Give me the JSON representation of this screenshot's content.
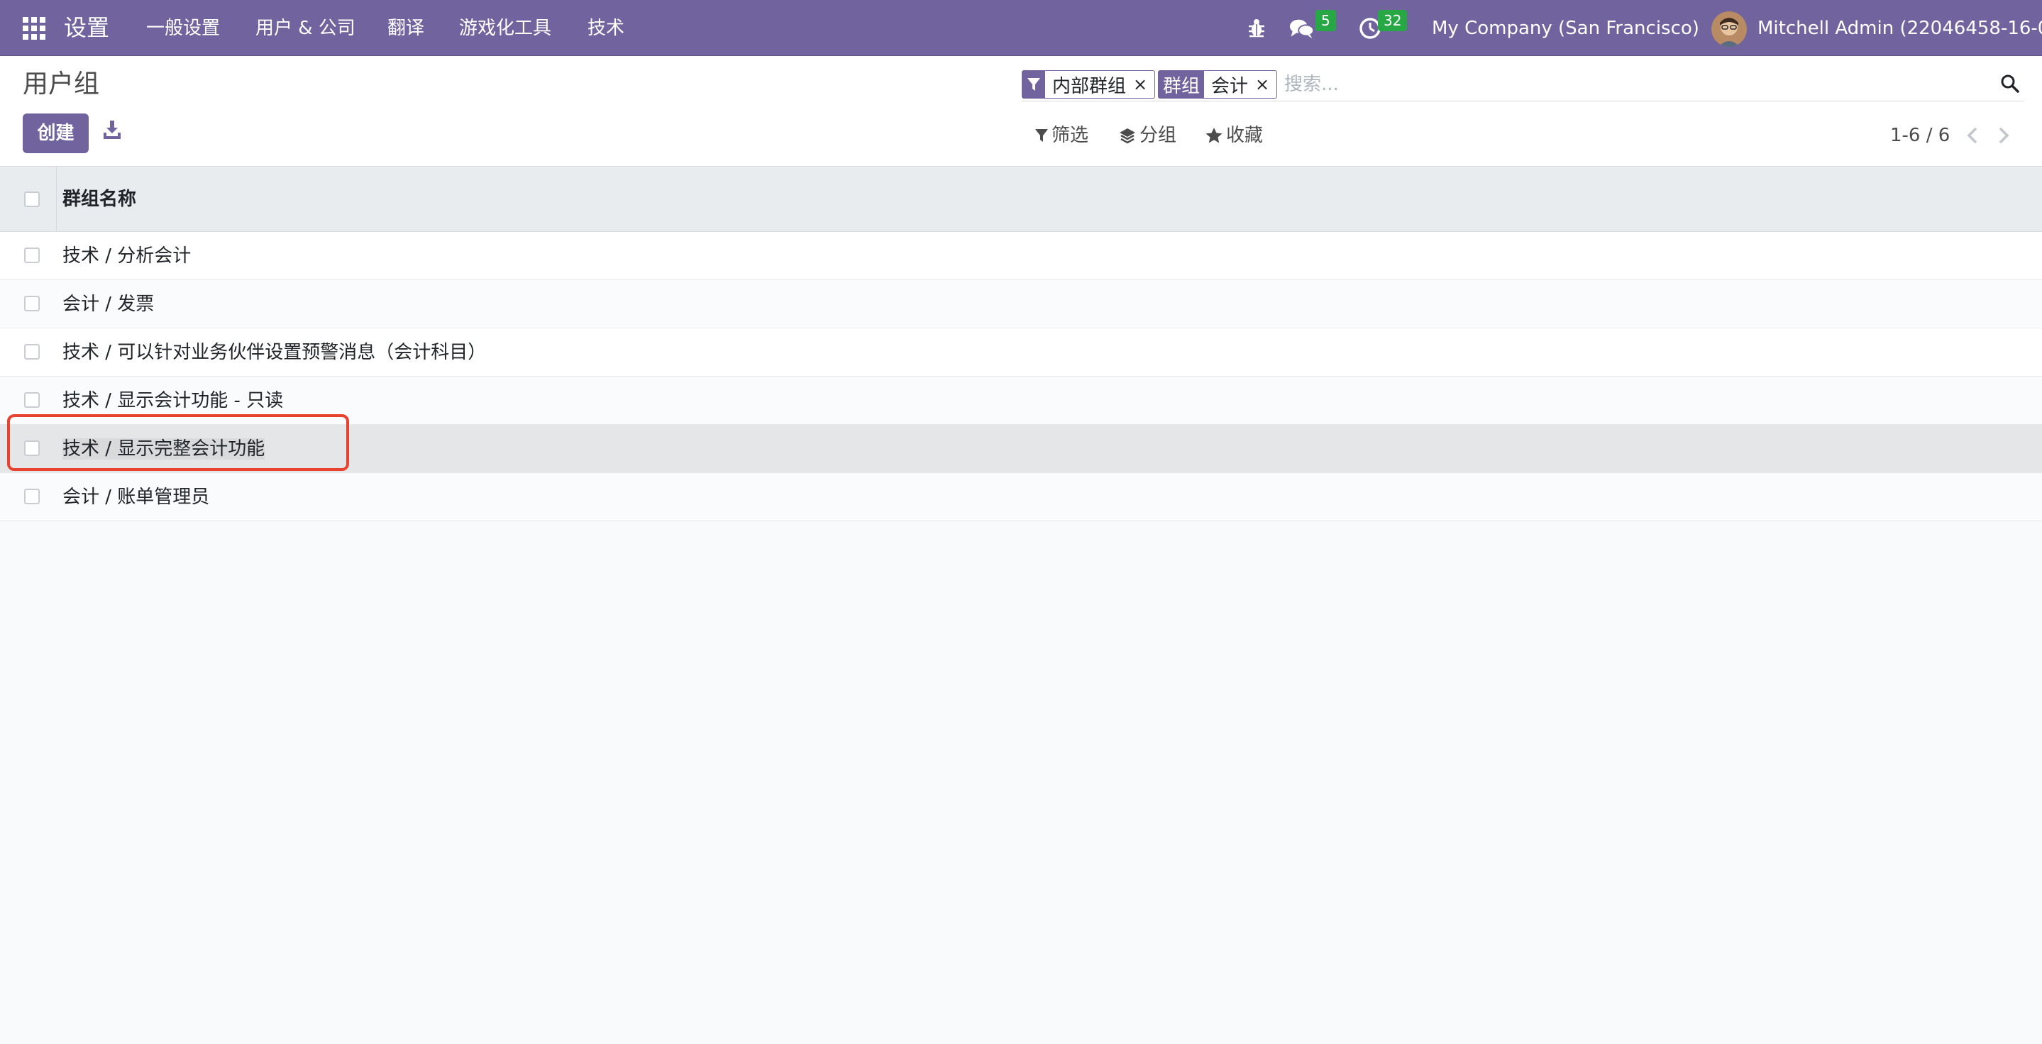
{
  "navbar": {
    "app_name": "设置",
    "menu": [
      "一般设置",
      "用户 & 公司",
      "翻译",
      "游戏化工具",
      "技术"
    ],
    "messages_count": "5",
    "activities_count": "32",
    "company": "My Company (San Francisco)",
    "user": "Mitchell Admin (22046458-16-0-"
  },
  "control_panel": {
    "title": "用户组",
    "create_label": "创建",
    "search": {
      "facets": [
        {
          "type": "filter",
          "value": "内部群组"
        },
        {
          "label": "群组",
          "value": "会计"
        }
      ],
      "placeholder": "搜索..."
    },
    "filters_label": "筛选",
    "groupby_label": "分组",
    "favorites_label": "收藏",
    "pager": "1-6 / 6"
  },
  "list": {
    "column": "群组名称",
    "rows": [
      "技术 / 分析会计",
      "会计 / 发票",
      "技术 / 可以针对业务伙伴设置预警消息（会计科目）",
      "技术 / 显示会计功能 - 只读",
      "技术 / 显示完整会计功能",
      "会计 / 账单管理员"
    ],
    "highlighted_row_index": 4
  },
  "colors": {
    "brand": "#71639e",
    "badge": "#28a745",
    "highlight_border": "#e7432f"
  }
}
